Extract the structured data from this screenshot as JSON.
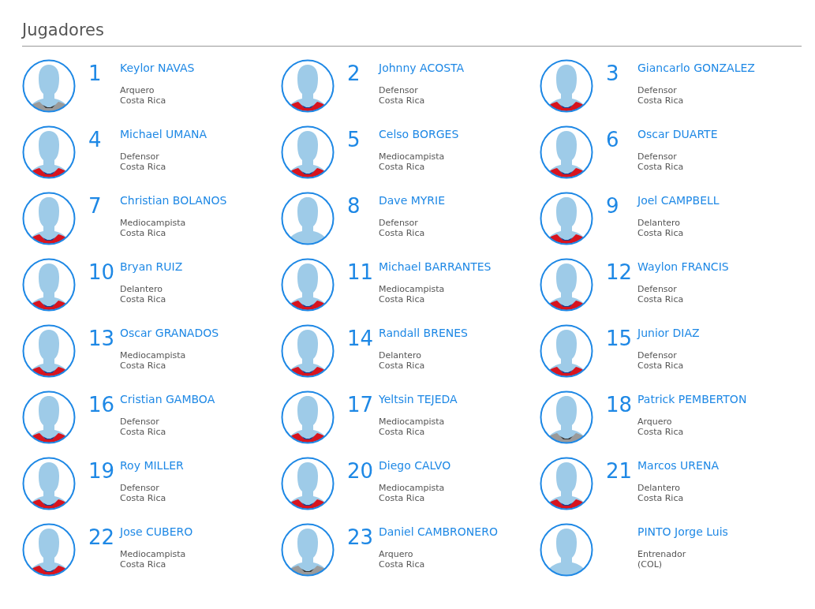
{
  "title": "Jugadores",
  "players": [
    {
      "number": "1",
      "name": "Keylor NAVAS",
      "role": "Arquero",
      "country": "Costa Rica",
      "kind": "keeper"
    },
    {
      "number": "2",
      "name": "Johnny ACOSTA",
      "role": "Defensor",
      "country": "Costa Rica",
      "kind": "field"
    },
    {
      "number": "3",
      "name": "Giancarlo GONZALEZ",
      "role": "Defensor",
      "country": "Costa Rica",
      "kind": "field"
    },
    {
      "number": "4",
      "name": "Michael UMANA",
      "role": "Defensor",
      "country": "Costa Rica",
      "kind": "field"
    },
    {
      "number": "5",
      "name": "Celso BORGES",
      "role": "Mediocampista",
      "country": "Costa Rica",
      "kind": "field"
    },
    {
      "number": "6",
      "name": "Oscar DUARTE",
      "role": "Defensor",
      "country": "Costa Rica",
      "kind": "field"
    },
    {
      "number": "7",
      "name": "Christian BOLANOS",
      "role": "Mediocampista",
      "country": "Costa Rica",
      "kind": "field"
    },
    {
      "number": "8",
      "name": "Dave MYRIE",
      "role": "Defensor",
      "country": "Costa Rica",
      "kind": "plain"
    },
    {
      "number": "9",
      "name": "Joel CAMPBELL",
      "role": "Delantero",
      "country": "Costa Rica",
      "kind": "field"
    },
    {
      "number": "10",
      "name": "Bryan RUIZ",
      "role": "Delantero",
      "country": "Costa Rica",
      "kind": "field"
    },
    {
      "number": "11",
      "name": "Michael BARRANTES",
      "role": "Mediocampista",
      "country": "Costa Rica",
      "kind": "field"
    },
    {
      "number": "12",
      "name": "Waylon FRANCIS",
      "role": "Defensor",
      "country": "Costa Rica",
      "kind": "field"
    },
    {
      "number": "13",
      "name": "Oscar GRANADOS",
      "role": "Mediocampista",
      "country": "Costa Rica",
      "kind": "field"
    },
    {
      "number": "14",
      "name": "Randall BRENES",
      "role": "Delantero",
      "country": "Costa Rica",
      "kind": "field"
    },
    {
      "number": "15",
      "name": "Junior DIAZ",
      "role": "Defensor",
      "country": "Costa Rica",
      "kind": "field"
    },
    {
      "number": "16",
      "name": "Cristian GAMBOA",
      "role": "Defensor",
      "country": "Costa Rica",
      "kind": "field"
    },
    {
      "number": "17",
      "name": "Yeltsin TEJEDA",
      "role": "Mediocampista",
      "country": "Costa Rica",
      "kind": "field"
    },
    {
      "number": "18",
      "name": "Patrick PEMBERTON",
      "role": "Arquero",
      "country": "Costa Rica",
      "kind": "keeper"
    },
    {
      "number": "19",
      "name": "Roy MILLER",
      "role": "Defensor",
      "country": "Costa Rica",
      "kind": "field"
    },
    {
      "number": "20",
      "name": "Diego CALVO",
      "role": "Mediocampista",
      "country": "Costa Rica",
      "kind": "field"
    },
    {
      "number": "21",
      "name": "Marcos URENA",
      "role": "Delantero",
      "country": "Costa Rica",
      "kind": "field"
    },
    {
      "number": "22",
      "name": "Jose CUBERO",
      "role": "Mediocampista",
      "country": "Costa Rica",
      "kind": "field"
    },
    {
      "number": "23",
      "name": "Daniel CAMBRONERO",
      "role": "Arquero",
      "country": "Costa Rica",
      "kind": "keeper"
    },
    {
      "name": "PINTO Jorge Luis",
      "role": "Entrenador",
      "country": "(COL)",
      "kind": "plain"
    }
  ]
}
